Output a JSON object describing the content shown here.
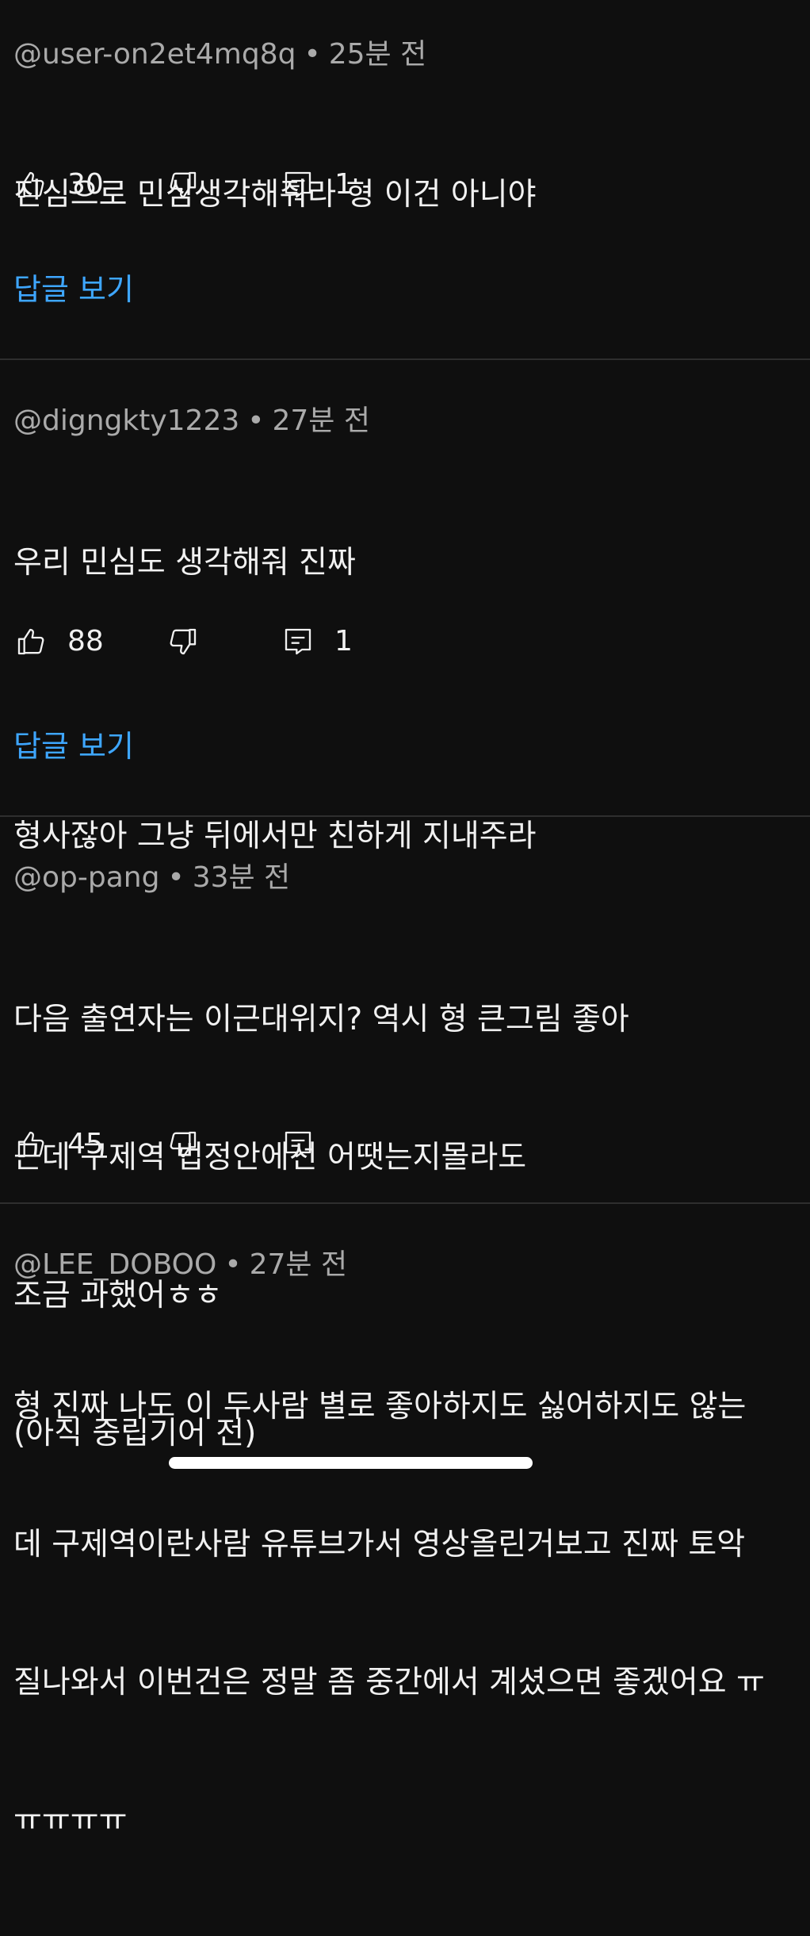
{
  "comments": [
    {
      "author": "@user-on2et4mq8q",
      "time": "25분 전",
      "lines": [
        "진심으로 민심생각해줘라 형 이건 아니야"
      ],
      "likes": "30",
      "reply_count": "1",
      "view_replies": "답글 보기"
    },
    {
      "author": "@digngkty1223",
      "time": "27분 전",
      "lines": [
        "우리 민심도 생각해줘 진짜",
        "",
        "형사잖아 그냥 뒤에서만 친하게 지내주라"
      ],
      "likes": "88",
      "reply_count": "1",
      "view_replies": "답글 보기"
    },
    {
      "author": "@op-pang",
      "time": "33분 전",
      "lines": [
        "다음 출연자는 이근대위지? 역시 형 큰그림 좋아",
        "근데 구제역 법정안에선 어땟는지몰라도",
        "조금 과했어ㅎㅎ",
        "(아직 중립기어 전)"
      ],
      "likes": "45",
      "reply_count": ""
    },
    {
      "author": "@LEE_DOBOO",
      "time": "27분 전",
      "lines": [
        "형 진짜 나도 이 두사람 별로 좋아하지도 싫어하지도 않는",
        "데 구제역이란사람 유튜브가서 영상올린거보고 진짜 토악",
        "질나와서 이번건은 정말 좀 중간에서 계셨으면 좋겠어요 ㅠ",
        "ㅠㅠㅠㅠ"
      ]
    }
  ],
  "icons": {
    "like": "thumbs-up-icon",
    "dislike": "thumbs-down-icon",
    "reply": "comment-reply-icon"
  },
  "colors": {
    "background": "#0f0f0f",
    "link": "#3ea6ff",
    "meta": "#aaaaaa",
    "text": "#f1f1f1"
  }
}
